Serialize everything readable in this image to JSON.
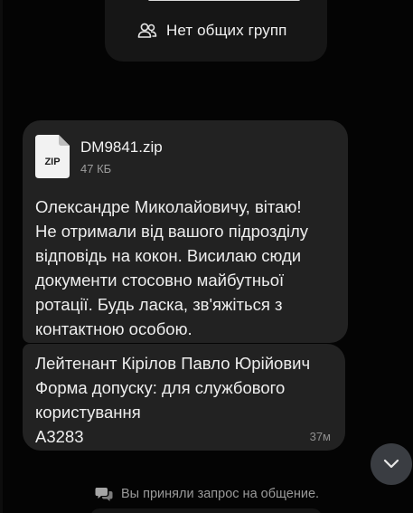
{
  "profile_card": {
    "groups_label": "Нет общих групп",
    "groups_icon": "people-icon"
  },
  "message": {
    "file": {
      "icon_label": "ZIP",
      "name": "DM9841.zip",
      "size": "47 КБ"
    },
    "text": "Олександре Миколайовичу, вітаю!\nНе отримали від вашого підрозділу\nвідповідь на кокон. Висилаю сюди\nдокументи стосовно майбутньої\nротації. Будь ласка, зв'яжіться з\nконтактною особою."
  },
  "signature_message": {
    "text": "Лейтенант Кірілов Павло Юрійович\nФорма допуску: для службового\nкористування\nА3283",
    "time": "37м"
  },
  "notice": {
    "icon": "chat-bubbles-icon",
    "text": "Вы приняли запрос на общение."
  },
  "colors": {
    "background": "#040404",
    "bubble": "#222222",
    "fab": "#3a3d42"
  }
}
